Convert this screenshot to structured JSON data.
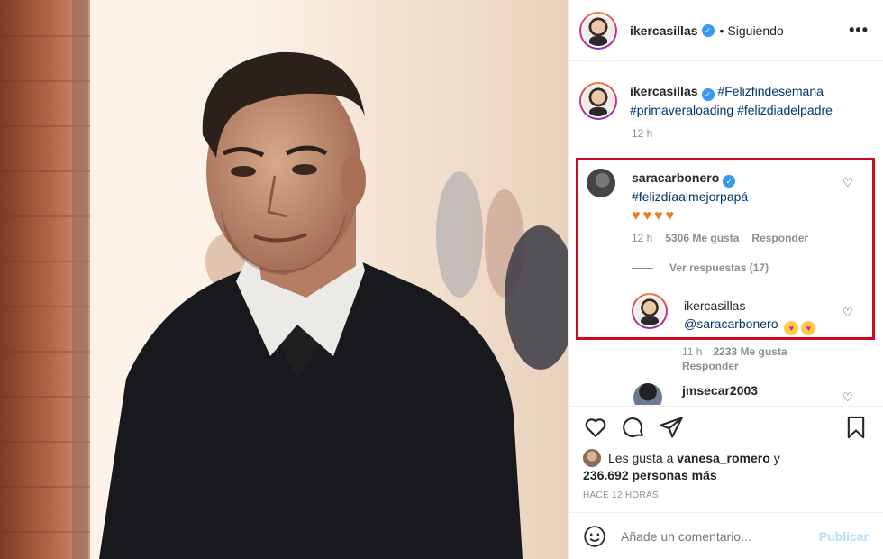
{
  "post": {
    "author": "ikercasillas",
    "follow_dot": "•",
    "follow_state": "Siguiendo",
    "more_label": "•••"
  },
  "caption": {
    "user": "ikercasillas",
    "tag1": "#Felizfindesemana",
    "tag2": "#primaveraloading",
    "tag3": "#felizdiadelpadre",
    "time": "12 h"
  },
  "comments": [
    {
      "user": "saracarbonero",
      "text": "#felizdíaalmejorpapá",
      "emoji_hearts": "♥♥♥♥",
      "time": "12 h",
      "likes": "5306 Me gusta",
      "reply_label": "Responder",
      "view_replies": "Ver respuestas (17)"
    },
    {
      "user": "ikercasillas",
      "mention": "@saracarbonero",
      "time": "11 h",
      "likes": "2233 Me gusta",
      "reply_label": "Responder"
    },
    {
      "user": "jmsecar2003"
    }
  ],
  "likes": {
    "prefix": "Les gusta a",
    "user": "vanesa_romero",
    "conj": "y",
    "count": "236.692 personas más"
  },
  "timestamp": "HACE 12 HORAS",
  "add_comment": {
    "placeholder": "Añade un comentario...",
    "post_label": "Publicar"
  },
  "colors": {
    "highlight_border": "#d00920",
    "link": "#00376b",
    "verified": "#3897f0"
  }
}
